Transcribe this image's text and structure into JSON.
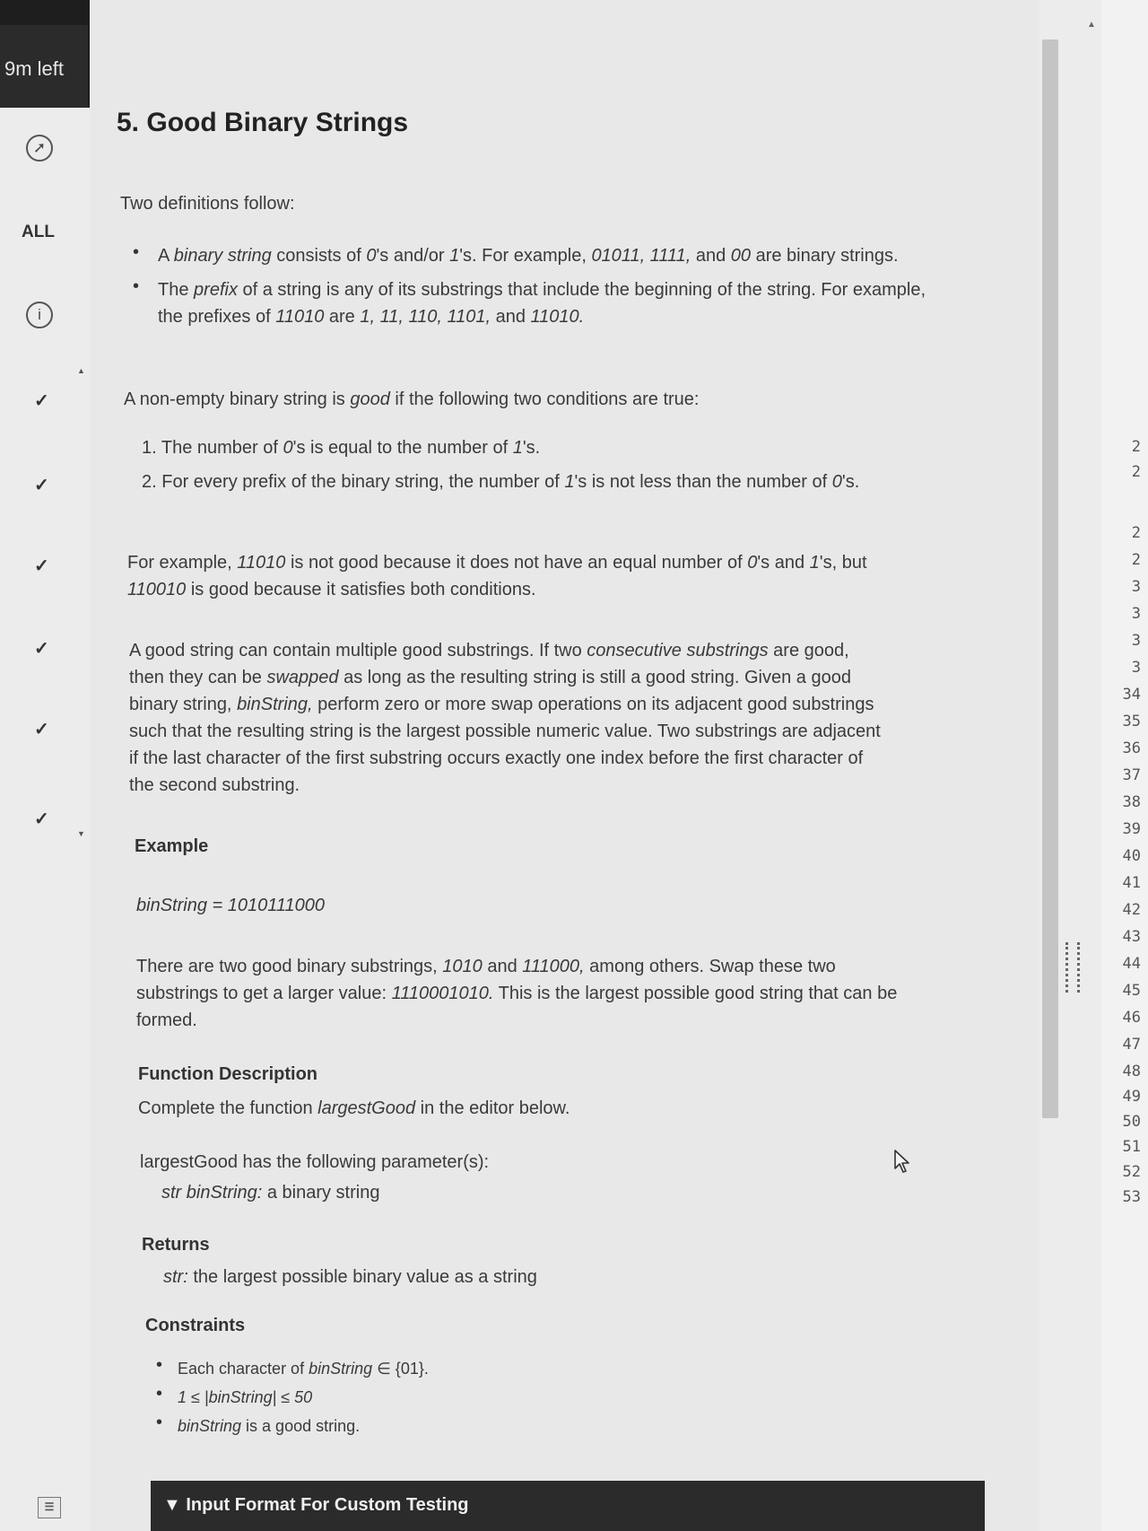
{
  "timer": "9m left",
  "nav": {
    "all_label": "ALL",
    "list_icon": "☰"
  },
  "problem": {
    "title": "5. Good Binary Strings",
    "intro": "Two definitions follow:",
    "def1": {
      "a": "A ",
      "term": "binary string",
      "b": " consists of ",
      "z": "0",
      "c": "'s and/or ",
      "o": "1",
      "d": "'s. For example, ",
      "ex": "01011, 1111,",
      "e": " and ",
      "ex2": "00",
      "f": " are binary strings."
    },
    "def2": {
      "a": "The ",
      "term": "prefix",
      "b": " of a string is any of its substrings that include the beginning of the string. For example,",
      "c": "the prefixes of ",
      "ex": "11010",
      "d": " are ",
      "list": "1, 11, 110, 1101,",
      "e": " and ",
      "last": "11010."
    },
    "good_intro": {
      "a": "A non-empty binary string is ",
      "term": "good",
      "b": " if the following two conditions are true:"
    },
    "cond1": {
      "a": "1. The number of ",
      "z": "0",
      "b": "'s is equal to the number of ",
      "o": "1",
      "c": "'s."
    },
    "cond2": {
      "a": "2. For every prefix of the binary string, the number of ",
      "o": "1",
      "b": "'s is not less than the number of ",
      "z": "0",
      "c": "'s."
    },
    "example_para": {
      "a": "For example, ",
      "s1": "11010",
      "b": " is not good because it does not have an equal number of ",
      "z": "0",
      "c": "'s and ",
      "o": "1",
      "d": "'s, but",
      "s2": "110010",
      "e": " is good because it satisfies both conditions."
    },
    "swap_para": {
      "l1a": "A good string can contain multiple good substrings. If two ",
      "l1i": "consecutive substrings",
      "l1b": " are good,",
      "l2a": "then they can be ",
      "l2i": "swapped",
      "l2b": " as long as the resulting string is still a good string. Given a good",
      "l3a": "binary string, ",
      "l3i": "binString,",
      "l3b": " perform zero or more swap operations on its adjacent good substrings",
      "l4": "such that the resulting string is the largest possible numeric value. Two substrings are adjacent",
      "l5": "if the last character of the first substring occurs exactly one index before the first character of",
      "l6": "the second substring."
    },
    "example_heading": "Example",
    "example_value": "binString = 1010111000",
    "explanation": {
      "a": "There are two good binary substrings, ",
      "s1": "1010",
      "b": " and ",
      "s2": "111000,",
      "c": " among others. Swap these two",
      "d": "substrings to get a larger value: ",
      "s3": "1110001010.",
      "e": " This is the largest possible good string that can be",
      "f": "formed."
    },
    "func_heading": "Function Description",
    "func_desc": {
      "a": "Complete the function ",
      "name": "largestGood",
      "b": " in the editor below."
    },
    "params_intro": "largestGood has the following parameter(s):",
    "param1": {
      "type": "str binString:",
      "desc": "  a binary string"
    },
    "returns_heading": "Returns",
    "returns": {
      "type": "str:",
      "desc": " the largest possible binary value as a string"
    },
    "constraints_heading": "Constraints",
    "c1": {
      "a": "Each character of ",
      "v": "binString",
      "b": " ∈ {01}."
    },
    "c2": "1 ≤ |binString| ≤ 50",
    "c3": {
      "v": "binString",
      "b": " is a good string."
    },
    "input_format": "▼ Input Format For Custom Testing"
  },
  "gutter_lines": [
    "2",
    "2",
    "2",
    "2",
    "3",
    "3",
    "3",
    "3",
    "34",
    "35",
    "36",
    "37",
    "38",
    "39",
    "40",
    "41",
    "42",
    "43",
    "44",
    "45",
    "46",
    "47",
    "48",
    "49",
    "50",
    "51",
    "52",
    "53"
  ]
}
